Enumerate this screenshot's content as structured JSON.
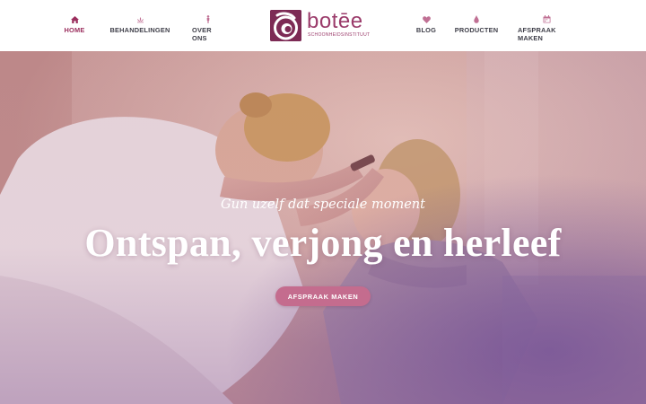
{
  "nav": {
    "left": [
      {
        "label": "HOME",
        "icon": "home-icon",
        "active": true
      },
      {
        "label": "BEHANDELINGEN",
        "icon": "lotus-icon"
      },
      {
        "label": "OVER ONS",
        "icon": "person-icon"
      }
    ],
    "right": [
      {
        "label": "BLOG",
        "icon": "heart-icon"
      },
      {
        "label": "PRODUCTEN",
        "icon": "drop-icon"
      },
      {
        "label": "AFSPRAAK MAKEN",
        "icon": "calendar-icon"
      }
    ]
  },
  "logo": {
    "name": "botēe",
    "subtitle": "SCHOONHEIDSINSTITUUT",
    "icon": "logo-mark-icon"
  },
  "hero": {
    "tagline": "Gun uzelf dat speciale moment",
    "headline": "Ontspan, verjong en herleef",
    "cta_label": "AFSPRAAK MAKEN"
  },
  "colors": {
    "accent": "#9b2f5e",
    "nav_text": "#3f3f49",
    "logo": "#9b3c6b",
    "cta": "#c46c8e"
  }
}
